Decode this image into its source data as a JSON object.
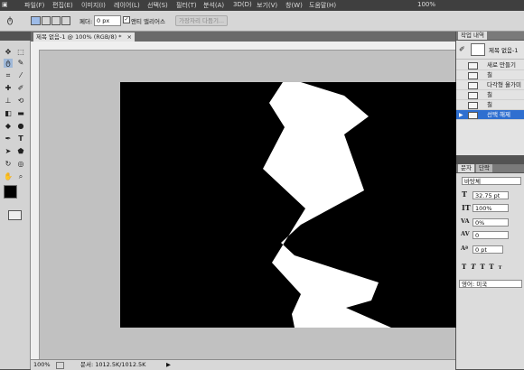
{
  "menu": [
    "파일(F)",
    "편집(E)",
    "이미지(I)",
    "레이어(L)",
    "선택(S)",
    "필터(T)",
    "분석(A)",
    "3D(D)",
    "보기(V)",
    "창(W)",
    "도움말(H)"
  ],
  "zoom_display": "100%",
  "options": {
    "feather_label": "페더:",
    "feather_value": "0 px",
    "antialias_label": "앤티 앨리어스",
    "refine_edge_label": "가장자리 다듬기..."
  },
  "document": {
    "tab_title": "제목 없음-1 @ 100% (RGB/8) *",
    "tab_close": "×",
    "status_zoom": "100%",
    "status_doc": "문서: 1012.5K/1012.5K"
  },
  "history": {
    "tab_label": "작업 내역",
    "snapshot_label": "제목 없음-1",
    "items": [
      "새로 만들기",
      "칠",
      "다각형 올가미",
      "칠",
      "칠",
      "선택 해제"
    ],
    "selected_index": 5
  },
  "character": {
    "tabs": [
      "문자",
      "단락"
    ],
    "font_family": "바탕체",
    "font_size": "32.75 pt",
    "vertical_scale": "100%",
    "tracking_left": "0%",
    "tracking": "0",
    "baseline_shift": "0 pt",
    "language": "영어: 미국"
  },
  "colors": {
    "canvas": "#000000",
    "shape": "#ffffff",
    "selection": "#2f6fd0",
    "workspace": "#c1c1c1"
  },
  "canvas_shape": "white-zigzag-polygon"
}
